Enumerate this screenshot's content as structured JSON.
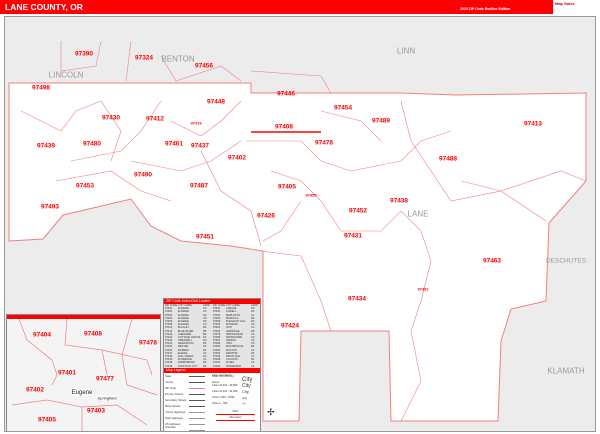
{
  "header": {
    "title": "LANE COUNTY, OR",
    "edition": "2023 ZIP Code Redline Edition",
    "logo_text": "Map Sales"
  },
  "counties": {
    "linn": "LINN",
    "benton": "BENTON",
    "lincoln": "LINCOLN",
    "lane": "LANE",
    "deschutes": "DESCHUTES",
    "klamath": "KLAMATH"
  },
  "zip_labels": [
    "97390",
    "97324",
    "97456",
    "97498",
    "97446",
    "97448",
    "97430",
    "97412",
    "97419",
    "97408",
    "97454",
    "97489",
    "97413",
    "97439",
    "97480",
    "97461",
    "97437",
    "97478",
    "97402",
    "97488",
    "97490",
    "97453",
    "97487",
    "97405",
    "97455",
    "97493",
    "97452",
    "97438",
    "97426",
    "97451",
    "97431",
    "97463",
    "97492",
    "97434",
    "97424"
  ],
  "inset": {
    "zips": [
      "97404",
      "97408",
      "97478",
      "97401",
      "97477",
      "97402",
      "97403",
      "97405"
    ],
    "places": [
      "Eugene",
      "Springfield"
    ]
  },
  "legend": {
    "index_title": "ZIP Code Index/Grid Locator",
    "columns": [
      "ZIP CODE",
      "CITY NAME",
      "GRID"
    ],
    "rows_left": [
      [
        "97401",
        "EUGENE",
        "C3"
      ],
      [
        "97402",
        "EUGENE",
        "C2"
      ],
      [
        "97403",
        "EUGENE",
        "D3"
      ],
      [
        "97404",
        "EUGENE",
        "C3"
      ],
      [
        "97405",
        "EUGENE",
        "D3"
      ],
      [
        "97408",
        "EUGENE",
        "C3"
      ],
      [
        "97412",
        "BLACHLY",
        "B2"
      ],
      [
        "97413",
        "BLUE RIVER",
        "B5"
      ],
      [
        "97419",
        "CHESHIRE",
        "B2"
      ],
      [
        "97424",
        "COTTAGE GROVE",
        "E3"
      ],
      [
        "97426",
        "CRESWELL",
        "D3"
      ],
      [
        "97430",
        "DEADWOOD",
        "B2"
      ],
      [
        "97431",
        "DEXTER",
        "D4"
      ],
      [
        "97434",
        "DORENA",
        "E4"
      ],
      [
        "97437",
        "ELMIRA",
        "C2"
      ],
      [
        "97438",
        "FALL CREEK",
        "D4"
      ],
      [
        "97439",
        "FLORENCE",
        "C1"
      ],
      [
        "97446",
        "HARRISBURG",
        "B3"
      ],
      [
        "97448",
        "JUNCTION CITY",
        "B3"
      ]
    ],
    "rows_right": [
      [
        "97451",
        "LORANE",
        "D2"
      ],
      [
        "97452",
        "LOWELL",
        "D4"
      ],
      [
        "97453",
        "MAPLETON",
        "C1"
      ],
      [
        "97454",
        "MARCOLA",
        "B4"
      ],
      [
        "97455",
        "PLEASANT HILL",
        "D4"
      ],
      [
        "97456",
        "MONROE",
        "A3"
      ],
      [
        "97461",
        "NOTI",
        "C2"
      ],
      [
        "97463",
        "OAKRIDGE",
        "D5"
      ],
      [
        "97478",
        "SPRINGFIELD",
        "C4"
      ],
      [
        "97480",
        "SWISSHOME",
        "C2"
      ],
      [
        "97487",
        "VENETA",
        "C2"
      ],
      [
        "97488",
        "VIDA",
        "C5"
      ],
      [
        "97489",
        "WALTERVILLE",
        "B4"
      ],
      [
        "97490",
        "WALTON",
        "C2"
      ],
      [
        "97492",
        "WESTFIR",
        "E5"
      ],
      [
        "97493",
        "WESTLAKE",
        "C1"
      ],
      [
        "97498",
        "YACHATS",
        "B1"
      ],
      [
        "97324",
        "ALSEA",
        "A2"
      ],
      [
        "97390",
        "TIDEWATER",
        "A1"
      ]
    ],
    "map_legend_title": "Map Legend",
    "line_items": [
      "State",
      "County",
      "ZIP Code",
      "Primary Streets",
      "Secondary Streets",
      "Minor Streets",
      "County Highways",
      "State Highways",
      "US Highways",
      "Interstate Highways",
      "Toll Roads"
    ],
    "cities_title": "Cities and Towns",
    "city_items": [
      [
        "Cities 100,000 and above",
        "City"
      ],
      [
        "Cities 25,000 - 99,999",
        "City"
      ],
      [
        "Cities 10,000 - 24,999",
        "City"
      ],
      [
        "Cities 1,000 - 9,999",
        "City"
      ],
      [
        "Cities 1 - 999",
        "City"
      ]
    ],
    "scale_miles": "Miles",
    "scale_km": "Kilometers"
  },
  "colors": {
    "accent": "#ff0000",
    "land": "#ffffff",
    "outside": "#ececec"
  }
}
